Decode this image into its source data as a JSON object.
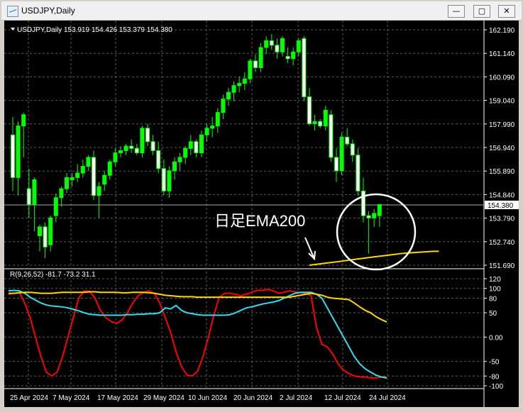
{
  "window": {
    "title": "USDJPY,Daily",
    "buttons": {
      "minimize": "—",
      "maximize": "▢",
      "close": "✕"
    }
  },
  "colors": {
    "background": "#000000",
    "grid": "#5a5a5a",
    "axis_text": "#ffffff",
    "candle": "#00ff00",
    "candle_body": "#ffffff",
    "ema": "#ffd700",
    "line_red": "#ff0000",
    "line_cyan": "#33ddee",
    "line_yellow": "#ffd700",
    "annotation": "#ffffff"
  },
  "chart_data": [
    {
      "type": "candlestick",
      "title": "USDJPY,Daily",
      "header": "USDJPY,Daily  153.919 154.426 153.379 154.380",
      "y_ticks": [
        "162.190",
        "161.140",
        "160.090",
        "159.040",
        "157.990",
        "156.940",
        "155.890",
        "154.840",
        "153.790",
        "152.740",
        "151.690"
      ],
      "ylim": [
        151.69,
        162.19
      ],
      "current_price": "154.380",
      "x_labels": [
        "25 Apr 2024",
        "7 May 2024",
        "17 May 2024",
        "29 May 2024",
        "10 Jun 2024",
        "20 Jun 2024",
        "2 Jul 2024",
        "12 Jul 2024",
        "24 Jul 2024"
      ],
      "annotation": "日足EMA200",
      "candles": [
        [
          157.5,
          158.3,
          155.0,
          155.6
        ],
        [
          155.6,
          158.1,
          154.8,
          157.9
        ],
        [
          157.9,
          158.5,
          156.5,
          158.4
        ],
        [
          155.1,
          156.0,
          153.8,
          154.4
        ],
        [
          154.4,
          155.6,
          153.2,
          155.5
        ],
        [
          153.0,
          153.5,
          152.3,
          153.4
        ],
        [
          153.4,
          153.6,
          152.0,
          152.5
        ],
        [
          152.6,
          153.9,
          152.3,
          153.8
        ],
        [
          153.9,
          154.9,
          153.6,
          154.7
        ],
        [
          154.7,
          155.2,
          154.3,
          155.1
        ],
        [
          155.1,
          155.8,
          154.9,
          155.6
        ],
        [
          155.5,
          155.8,
          155.2,
          155.6
        ],
        [
          155.6,
          156.2,
          155.4,
          155.8
        ],
        [
          155.8,
          156.4,
          155.6,
          156.1
        ],
        [
          156.1,
          156.6,
          155.9,
          156.5
        ],
        [
          156.5,
          156.8,
          154.6,
          154.8
        ],
        [
          154.8,
          155.4,
          153.8,
          155.2
        ],
        [
          155.3,
          155.9,
          155.0,
          155.7
        ],
        [
          155.7,
          156.4,
          155.5,
          156.3
        ],
        [
          156.3,
          156.9,
          156.1,
          156.7
        ],
        [
          156.7,
          157.0,
          156.5,
          156.8
        ],
        [
          156.8,
          157.1,
          156.6,
          157.0
        ],
        [
          157.0,
          157.3,
          156.7,
          156.9
        ],
        [
          156.9,
          157.1,
          156.6,
          156.7
        ],
        [
          156.7,
          157.9,
          156.5,
          157.8
        ],
        [
          157.8,
          158.0,
          157.0,
          157.2
        ],
        [
          157.2,
          157.5,
          156.6,
          156.8
        ],
        [
          156.8,
          157.2,
          155.8,
          156.0
        ],
        [
          156.0,
          156.4,
          154.8,
          155.0
        ],
        [
          155.0,
          156.1,
          154.7,
          155.9
        ],
        [
          155.9,
          156.5,
          155.5,
          156.3
        ],
        [
          156.3,
          156.7,
          155.9,
          156.5
        ],
        [
          156.5,
          157.0,
          156.2,
          156.9
        ],
        [
          156.9,
          157.5,
          156.6,
          157.2
        ],
        [
          157.2,
          157.3,
          156.5,
          156.7
        ],
        [
          156.7,
          157.7,
          156.5,
          157.5
        ],
        [
          157.5,
          158.0,
          157.2,
          157.8
        ],
        [
          157.8,
          158.3,
          157.4,
          157.9
        ],
        [
          157.9,
          158.7,
          157.6,
          158.5
        ],
        [
          158.5,
          159.3,
          158.2,
          159.1
        ],
        [
          159.1,
          159.6,
          158.8,
          159.4
        ],
        [
          159.4,
          159.9,
          159.0,
          159.7
        ],
        [
          159.7,
          160.1,
          159.4,
          159.8
        ],
        [
          159.8,
          160.3,
          159.5,
          160.0
        ],
        [
          160.0,
          160.9,
          159.8,
          160.8
        ],
        [
          160.8,
          161.1,
          160.3,
          160.5
        ],
        [
          160.5,
          161.6,
          160.3,
          161.4
        ],
        [
          161.4,
          161.9,
          161.1,
          161.7
        ],
        [
          161.7,
          162.0,
          161.3,
          161.5
        ],
        [
          161.5,
          161.8,
          160.9,
          161.2
        ],
        [
          161.2,
          161.9,
          161.0,
          161.8
        ],
        [
          161.0,
          161.4,
          160.7,
          160.9
        ],
        [
          160.9,
          161.4,
          160.6,
          161.2
        ],
        [
          161.2,
          161.8,
          161.0,
          161.7
        ],
        [
          161.8,
          161.9,
          159.0,
          159.2
        ],
        [
          159.2,
          159.6,
          157.9,
          158.0
        ],
        [
          158.0,
          158.4,
          157.7,
          158.1
        ],
        [
          158.1,
          158.2,
          157.8,
          157.9
        ],
        [
          157.9,
          158.8,
          157.7,
          158.6
        ],
        [
          158.4,
          158.6,
          156.3,
          156.5
        ],
        [
          156.5,
          156.9,
          155.4,
          155.9
        ],
        [
          155.9,
          157.6,
          155.7,
          157.4
        ],
        [
          157.4,
          157.8,
          157.0,
          157.1
        ],
        [
          157.1,
          157.3,
          156.3,
          156.6
        ],
        [
          156.6,
          156.9,
          154.8,
          155.0
        ],
        [
          155.0,
          155.6,
          153.6,
          153.9
        ],
        [
          153.9,
          154.1,
          152.2,
          153.8
        ],
        [
          153.8,
          154.2,
          153.4,
          154.0
        ],
        [
          153.9,
          154.4,
          153.4,
          154.4
        ]
      ],
      "ema200": [
        [
          55,
          151.69
        ],
        [
          58,
          151.78
        ],
        [
          61,
          151.87
        ],
        [
          64,
          151.97
        ],
        [
          67,
          152.06
        ],
        [
          70,
          152.15
        ],
        [
          72,
          152.21
        ],
        [
          73,
          152.23
        ],
        [
          76,
          152.28
        ],
        [
          78,
          152.31
        ],
        [
          79,
          152.31
        ]
      ]
    },
    {
      "type": "line",
      "title": "R(9,26,52) -81.7 -73.2 31.1",
      "y_ticks": [
        "120",
        "100",
        "80",
        "50",
        "0.00",
        "-50",
        "-80",
        "-100"
      ],
      "ylim": [
        -100,
        120
      ],
      "series": [
        {
          "color": "#ff0000",
          "values": [
            88,
            90,
            92,
            70,
            40,
            0,
            -40,
            -72,
            -80,
            -72,
            -40,
            0,
            40,
            80,
            95,
            94,
            80,
            55,
            40,
            32,
            28,
            35,
            50,
            70,
            85,
            92,
            95,
            90,
            70,
            40,
            10,
            -30,
            -60,
            -78,
            -80,
            -70,
            -40,
            0,
            45,
            82,
            90,
            90,
            88,
            85,
            88,
            92,
            96,
            96,
            98,
            95,
            90,
            92,
            95,
            93,
            91,
            90,
            85,
            20,
            -15,
            -20,
            -35,
            -55,
            -68,
            -75,
            -80,
            -82,
            -82,
            -84,
            -84,
            -82,
            -82
          ]
        },
        {
          "color": "#33ddee",
          "values": [
            95,
            96,
            95,
            90,
            82,
            76,
            70,
            66,
            64,
            63,
            62,
            60,
            57,
            54,
            50,
            47,
            46,
            45,
            45,
            45,
            45,
            45,
            46,
            46,
            47,
            47,
            48,
            48,
            50,
            60,
            58,
            65,
            55,
            50,
            48,
            46,
            45,
            45,
            45,
            45,
            45,
            46,
            50,
            55,
            60,
            62,
            65,
            68,
            70,
            72,
            75,
            80,
            85,
            90,
            92,
            92,
            92,
            88,
            80,
            60,
            40,
            20,
            0,
            -20,
            -40,
            -55,
            -65,
            -72,
            -78,
            -82,
            -84
          ]
        },
        {
          "color": "#ffd700",
          "values": [
            90,
            90,
            91,
            92,
            92,
            91,
            90,
            90,
            90,
            91,
            92,
            92,
            92,
            92,
            92,
            93,
            93,
            92,
            92,
            92,
            92,
            91,
            91,
            92,
            92,
            92,
            91,
            90,
            88,
            86,
            85,
            84,
            83,
            83,
            83,
            82,
            82,
            82,
            82,
            82,
            82,
            82,
            82,
            82,
            82,
            82,
            82,
            82,
            82,
            82,
            82,
            82,
            82,
            84,
            86,
            88,
            90,
            88,
            86,
            82,
            80,
            79,
            78,
            77,
            70,
            62,
            55,
            50,
            42,
            36,
            31
          ]
        }
      ]
    }
  ]
}
